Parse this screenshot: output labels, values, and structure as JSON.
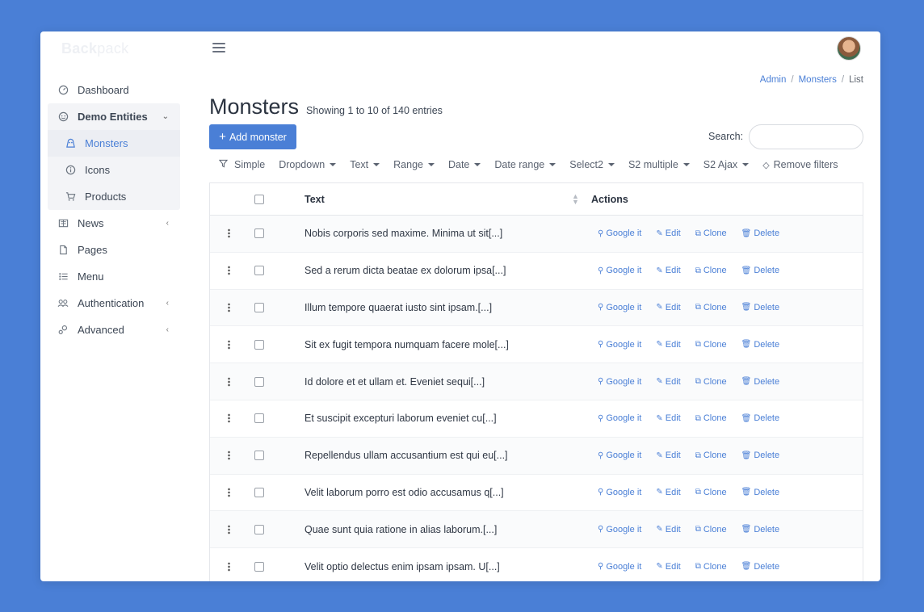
{
  "brand": {
    "part1": "Back",
    "part2": "pack"
  },
  "sidebar": {
    "items": [
      {
        "label": "Dashboard",
        "icon": "gauge-icon"
      },
      {
        "label": "Demo Entities",
        "icon": "smile-icon"
      },
      {
        "label": "Monsters",
        "icon": "monster-icon"
      },
      {
        "label": "Icons",
        "icon": "info-icon"
      },
      {
        "label": "Products",
        "icon": "cart-icon"
      },
      {
        "label": "News",
        "icon": "newspaper-icon"
      },
      {
        "label": "Pages",
        "icon": "file-icon"
      },
      {
        "label": "Menu",
        "icon": "list-icon"
      },
      {
        "label": "Authentication",
        "icon": "users-icon"
      },
      {
        "label": "Advanced",
        "icon": "cogs-icon"
      }
    ]
  },
  "breadcrumb": {
    "admin": "Admin",
    "monsters": "Monsters",
    "current": "List",
    "separator": "/"
  },
  "page": {
    "title": "Monsters",
    "subtitle": "Showing 1 to 10 of 140 entries"
  },
  "toolbar": {
    "add_label": "Add monster",
    "search_label": "Search:",
    "search_value": ""
  },
  "filters": {
    "simple": "Simple",
    "items": [
      "Dropdown",
      "Text",
      "Range",
      "Date",
      "Date range",
      "Select2",
      "S2 multiple",
      "S2 Ajax"
    ],
    "remove": "Remove filters"
  },
  "table": {
    "columns": {
      "text": "Text",
      "actions": "Actions"
    },
    "actions": {
      "google": "Google it",
      "edit": "Edit",
      "clone": "Clone",
      "delete": "Delete"
    },
    "rows": [
      "Nobis corporis sed maxime. Minima ut sit[...]",
      "Sed a rerum dicta beatae ex dolorum ipsa[...]",
      "Illum tempore quaerat iusto sint ipsam.[...]",
      "Sit ex fugit tempora numquam facere mole[...]",
      "Id dolore et et ullam et. Eveniet sequi[...]",
      "Et suscipit excepturi laborum eveniet cu[...]",
      "Repellendus ullam accusantium est qui eu[...]",
      "Velit laborum porro est odio accusamus q[...]",
      "Quae sunt quia ratione in alias laborum.[...]",
      "Velit optio delectus enim ipsam ipsam. U[...]"
    ]
  },
  "colors": {
    "background": "#4a7fd6",
    "accent": "#4a7fd6",
    "panel": "#ffffff"
  }
}
